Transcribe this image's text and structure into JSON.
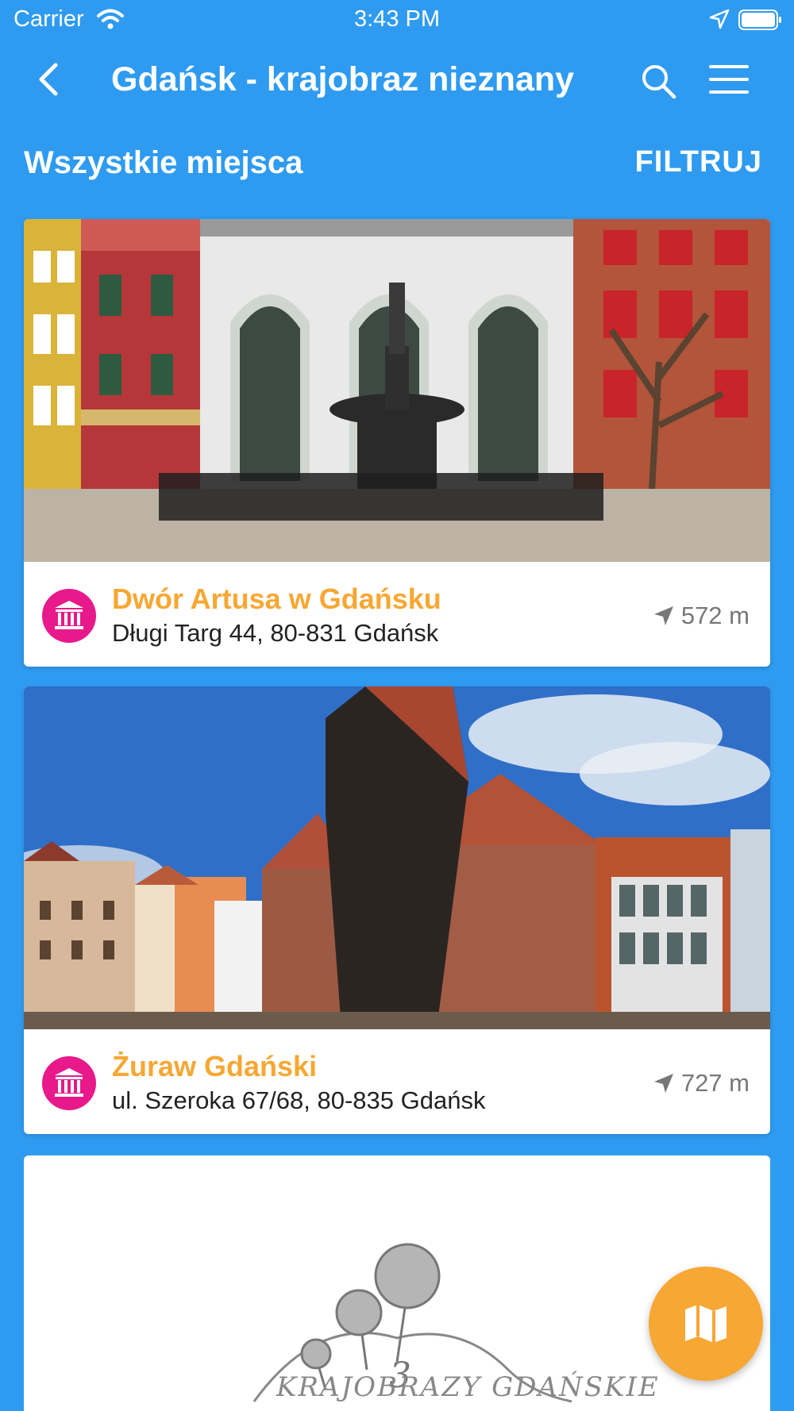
{
  "status_bar": {
    "carrier": "Carrier",
    "time": "3:43 PM"
  },
  "nav": {
    "title": "Gdańsk - krajobraz nieznany",
    "icons": [
      "back-chevron-icon",
      "search-icon",
      "hamburger-menu-icon"
    ]
  },
  "section": {
    "title": "Wszystkie miejsca",
    "filter_label": "FILTRUJ"
  },
  "places": [
    {
      "name": "Dwór Artusa w Gdańsku",
      "address": "Długi Targ 44, 80-831 Gdańsk",
      "distance": "572 m",
      "category_icon": "museum-icon"
    },
    {
      "name": "Żuraw Gdański",
      "address": "ul. Szeroka 67/68, 80-835 Gdańsk",
      "distance": "727 m",
      "category_icon": "museum-icon"
    }
  ],
  "logo_card": {
    "logo_number": "3",
    "logo_text": "KRAJOBRAZY GDAŃSKIE"
  },
  "fab": {
    "icon": "map-icon"
  },
  "colors": {
    "primary_blue": "#2E9BF0",
    "accent_orange": "#F7A733",
    "category_pink": "#E8198B"
  }
}
